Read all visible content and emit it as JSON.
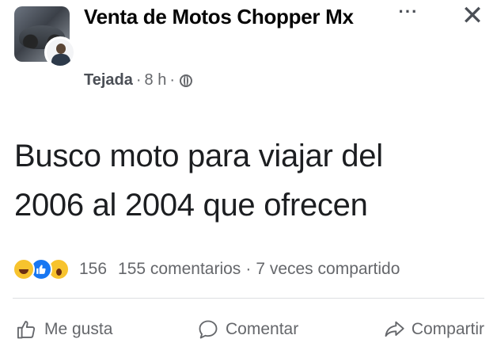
{
  "post": {
    "group_name": "Venta de Motos Chopper Mx",
    "author": "Tejada",
    "separator": "·",
    "time": "8 h",
    "audience_icon": "globe-icon",
    "more_glyph": "···",
    "close_glyph": "✕",
    "text_line1": "Busco moto para viajar del",
    "text_line2": "2006 al 2004 que ofrecen"
  },
  "stats": {
    "reactions": [
      "haha",
      "like",
      "wow"
    ],
    "reaction_count": "156",
    "comments": "155 comentarios",
    "dot": "·",
    "shares": "7 veces compartido"
  },
  "actions": {
    "like_label": "Me gusta",
    "comment_label": "Comentar",
    "share_label": "Compartir"
  },
  "colors": {
    "text": "#1c1e21",
    "secondary": "#65676b",
    "like_blue": "#1877f2",
    "reaction_yellow": "#f7c32e"
  }
}
